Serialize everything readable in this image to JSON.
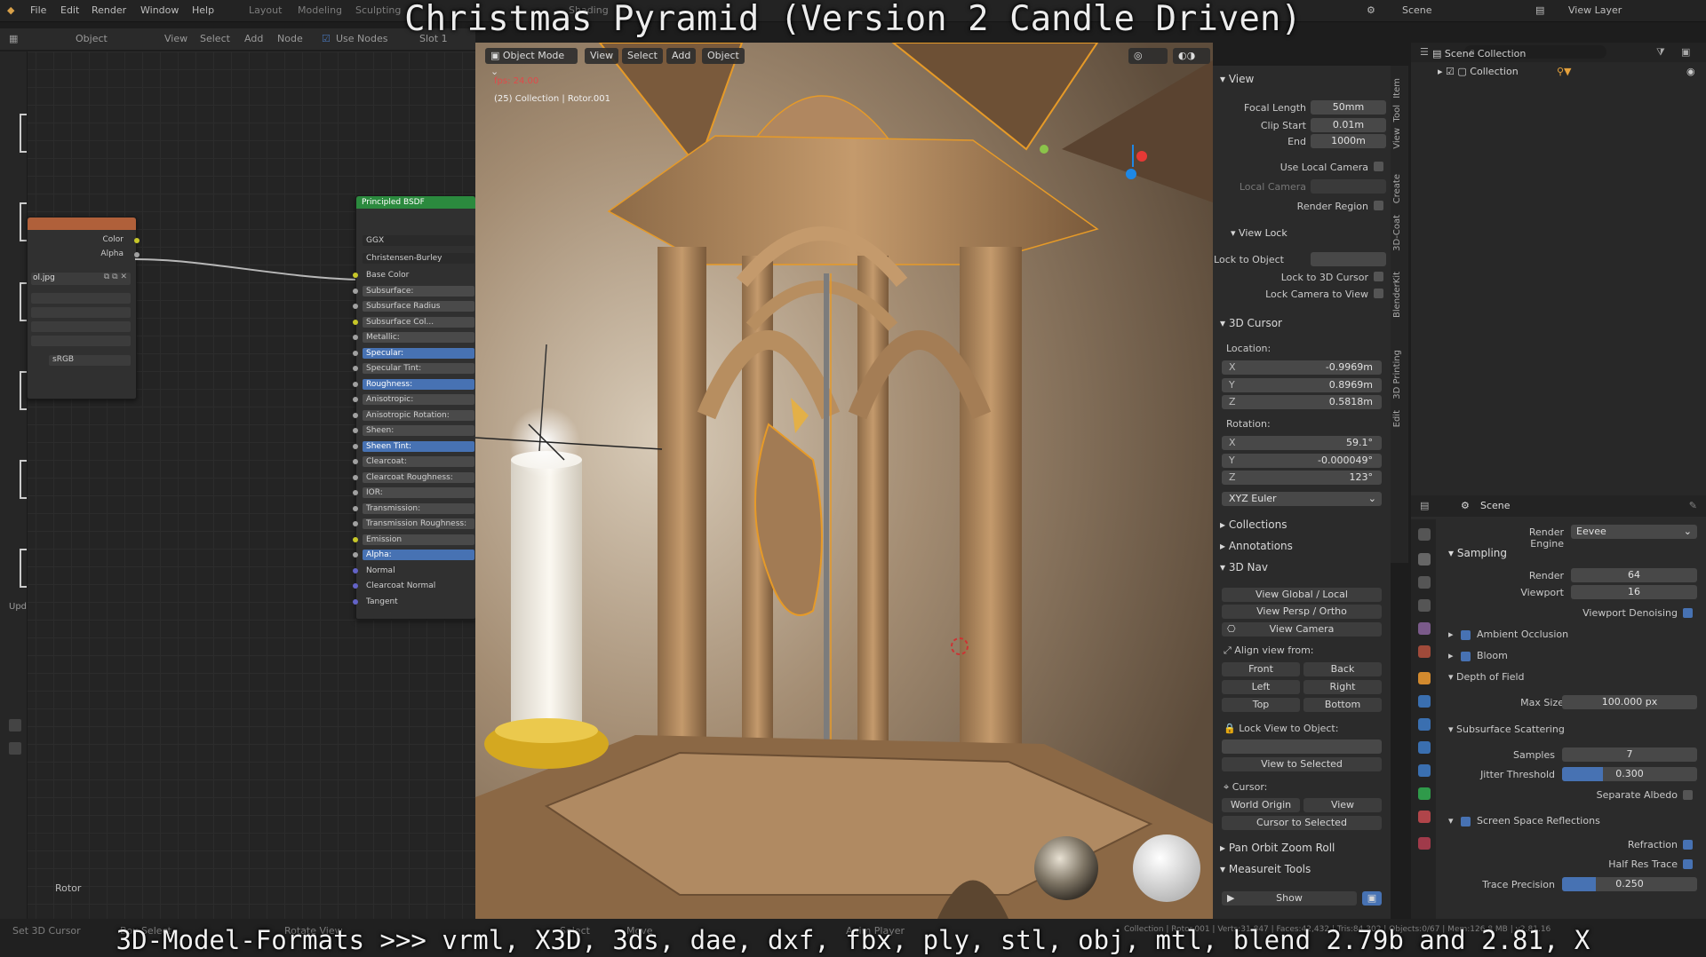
{
  "caption": {
    "title": "Christmas Pyramid (Version 2 Candle Driven)",
    "bottom": "3D-Model-Formats >>> vrml, X3D, 3ds, dae, dxf, fbx, ply, stl, obj, mtl, blend 2.79b and 2.81, X"
  },
  "menu": [
    "File",
    "Edit",
    "Render",
    "Window",
    "Help"
  ],
  "workspace_tabs": [
    "Layout",
    "Modeling",
    "Sculpting",
    "Shading"
  ],
  "top_right": {
    "scene": "Scene",
    "view_layer": "View Layer"
  },
  "node_editor": {
    "header": [
      "Object",
      "View",
      "Select",
      "Add",
      "Node",
      "Use Nodes",
      "Slot 1"
    ],
    "image_node": {
      "color_label": "Color",
      "alpha_label": "Alpha",
      "file": "ol.jpg",
      "colorspace": "sRGB"
    },
    "bsdf": {
      "title": "Principled BSDF",
      "distribution": "GGX",
      "subsurface_method": "Christensen-Burley",
      "inputs": [
        {
          "label": "Base Color",
          "style": "plain"
        },
        {
          "label": "Subsurface:",
          "style": "field"
        },
        {
          "label": "Subsurface Radius",
          "style": "field"
        },
        {
          "label": "Subsurface Col...",
          "style": "field"
        },
        {
          "label": "Metallic:",
          "style": "field"
        },
        {
          "label": "Specular:",
          "style": "hl"
        },
        {
          "label": "Specular Tint:",
          "style": "field"
        },
        {
          "label": "Roughness:",
          "style": "hl"
        },
        {
          "label": "Anisotropic:",
          "style": "field"
        },
        {
          "label": "Anisotropic Rotation:",
          "style": "field"
        },
        {
          "label": "Sheen:",
          "style": "field"
        },
        {
          "label": "Sheen Tint:",
          "style": "hl"
        },
        {
          "label": "Clearcoat:",
          "style": "field"
        },
        {
          "label": "Clearcoat Roughness:",
          "style": "field"
        },
        {
          "label": "IOR:",
          "style": "field"
        },
        {
          "label": "Transmission:",
          "style": "field"
        },
        {
          "label": "Transmission Roughness:",
          "style": "field"
        },
        {
          "label": "Emission",
          "style": "field"
        },
        {
          "label": "Alpha:",
          "style": "hl"
        },
        {
          "label": "Normal",
          "style": "plain"
        },
        {
          "label": "Clearcoat Normal",
          "style": "plain"
        },
        {
          "label": "Tangent",
          "style": "plain"
        }
      ]
    },
    "rotor_label": "Rotor",
    "left_label": "Upd"
  },
  "viewport": {
    "mode": "Object Mode",
    "menus": [
      "View",
      "Select",
      "Add",
      "Object"
    ],
    "info_line1": "fps: 24.00",
    "info_line2": "(25) Collection | Rotor.001"
  },
  "npanel": {
    "view_header": "View",
    "focal_length_label": "Focal Length",
    "focal_length": "50mm",
    "clip_start_label": "Clip Start",
    "clip_start": "0.01m",
    "clip_end_label": "End",
    "clip_end": "1000m",
    "use_local_camera": "Use Local Camera",
    "local_camera": "Local Camera",
    "render_region": "Render Region",
    "view_lock": "View Lock",
    "lock_to_object": "Lock to Object",
    "lock_to_3d_cursor": "Lock to 3D Cursor",
    "lock_camera_to_view": "Lock Camera to View",
    "cursor_header": "3D Cursor",
    "location": "Location:",
    "loc": [
      {
        "axis": "X",
        "value": "-0.9969m"
      },
      {
        "axis": "Y",
        "value": "0.8969m"
      },
      {
        "axis": "Z",
        "value": "0.5818m"
      }
    ],
    "rotation": "Rotation:",
    "rot": [
      {
        "axis": "X",
        "value": "59.1°"
      },
      {
        "axis": "Y",
        "value": "-0.000049°"
      },
      {
        "axis": "Z",
        "value": "123°"
      }
    ],
    "rotation_mode": "XYZ Euler",
    "collections": "Collections",
    "annotations": "Annotations",
    "nav_header": "3D Nav",
    "view_global_local": "View Global / Local",
    "view_persp_ortho": "View Persp / Ortho",
    "view_camera": "View Camera",
    "align_view_from": "Align view from:",
    "front": "Front",
    "back": "Back",
    "left": "Left",
    "right": "Right",
    "top": "Top",
    "bottom": "Bottom",
    "lock_view_to_object": "Lock View to Object:",
    "view_to_selected": "View to Selected",
    "cursor": "Cursor:",
    "world_origin": "World Origin",
    "view": "View",
    "cursor_to_selected": "Cursor to Selected",
    "pan_orbit": "Pan Orbit Zoom Roll",
    "measureit": "Measureit Tools",
    "show": "Show"
  },
  "side_tabs": [
    "Item",
    "Tool",
    "View",
    "Create",
    "3D-Coat",
    "BlenderKit",
    "3D Printing",
    "Edit"
  ],
  "outliner": {
    "scene_collection": "Scene Collection",
    "collection": "Collection"
  },
  "properties": {
    "scene": "Scene",
    "render_engine_label": "Render Engine",
    "render_engine": "Eevee",
    "sampling": "Sampling",
    "render_label": "Render",
    "render_samples": "64",
    "viewport_label": "Viewport",
    "viewport_samples": "16",
    "viewport_denoising": "Viewport Denoising",
    "ambient_occlusion": "Ambient Occlusion",
    "bloom": "Bloom",
    "depth_of_field": "Depth of Field",
    "max_size_label": "Max Size",
    "max_size": "100.000 px",
    "subsurface_scattering": "Subsurface Scattering",
    "samples_label": "Samples",
    "samples": "7",
    "jitter_label": "Jitter Threshold",
    "jitter": "0.300",
    "separate_albedo": "Separate Albedo",
    "ssr": "Screen Space Reflections",
    "refraction": "Refraction",
    "half_res_trace": "Half Res Trace",
    "trace_precision_label": "Trace Precision",
    "trace_precision": "0.250"
  },
  "status": {
    "left1": "Set 3D Cursor",
    "left2": "Box Select",
    "left3": "Rotate View",
    "mid1": "Select",
    "mid2": "Move",
    "mid3": "Anim Player",
    "right": "Collection | Rotor.001 | Verts:31,847 | Faces:42,432 | Tris:84,302 | Objects:0/67 | Mem:126.8 MB | v2.81.16"
  },
  "colors": {
    "accent": "#4772b3",
    "bsdf_header": "#2b8a3e",
    "image_header": "#b0603a",
    "selection_outline": "#f0a020"
  }
}
